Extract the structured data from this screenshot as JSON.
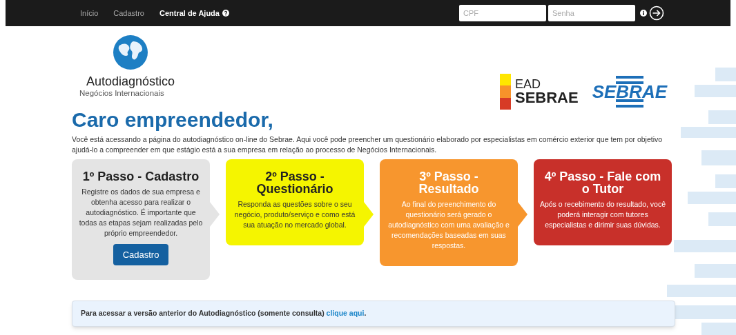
{
  "nav": {
    "items": [
      {
        "label": "Início",
        "kind": "link"
      },
      {
        "label": "Cadastro",
        "kind": "link"
      },
      {
        "label": "Central de Ajuda",
        "kind": "help"
      }
    ],
    "login": {
      "cpf_placeholder": "CPF",
      "password_placeholder": "Senha"
    }
  },
  "brand": {
    "title": "Autodiagnóstico",
    "subtitle": "Negócios Internacionais"
  },
  "partner_logos": {
    "ead_top": "EAD",
    "ead_bottom": "SEBRAE",
    "sebrae": "SEBRAE"
  },
  "heading": "Caro empreendedor,",
  "intro": "Você está acessando a página do autodiagnóstico on-line do Sebrae. Aqui você pode preencher um questionário elaborado por especialistas em comércio exterior que tem por objetivo ajudá-lo a compreender em que estágio está a sua empresa em relação ao processo de Negócios Internacionais.",
  "steps": [
    {
      "kind": "gray",
      "title": "1º Passo - Cadastro",
      "text": "Registre os dados de sua empresa e obtenha acesso para realizar o autodiagnóstico. É importante que todas as etapas sejam realizadas pelo próprio empreendedor.",
      "button": "Cadastro"
    },
    {
      "kind": "yellow",
      "title": "2º Passo - Questionário",
      "text": "Responda as questões sobre o seu negócio, produto/serviço e como está sua atuação no mercado global."
    },
    {
      "kind": "orange",
      "title": "3º Passo - Resultado",
      "text": "Ao final do preenchimento do questionário será gerado o autodiagnóstico com uma avaliação e recomendações baseadas em suas respostas."
    },
    {
      "kind": "red",
      "title": "4º Passo - Fale com o Tutor",
      "text": "Após o recebimento do resultado, você poderá interagir com tutores especialistas e dirimir suas dúvidas."
    }
  ],
  "notice": {
    "text": "Para acessar a versão anterior do Autodiagnóstico (somente consulta)",
    "link": "clique aqui",
    "end": "."
  }
}
